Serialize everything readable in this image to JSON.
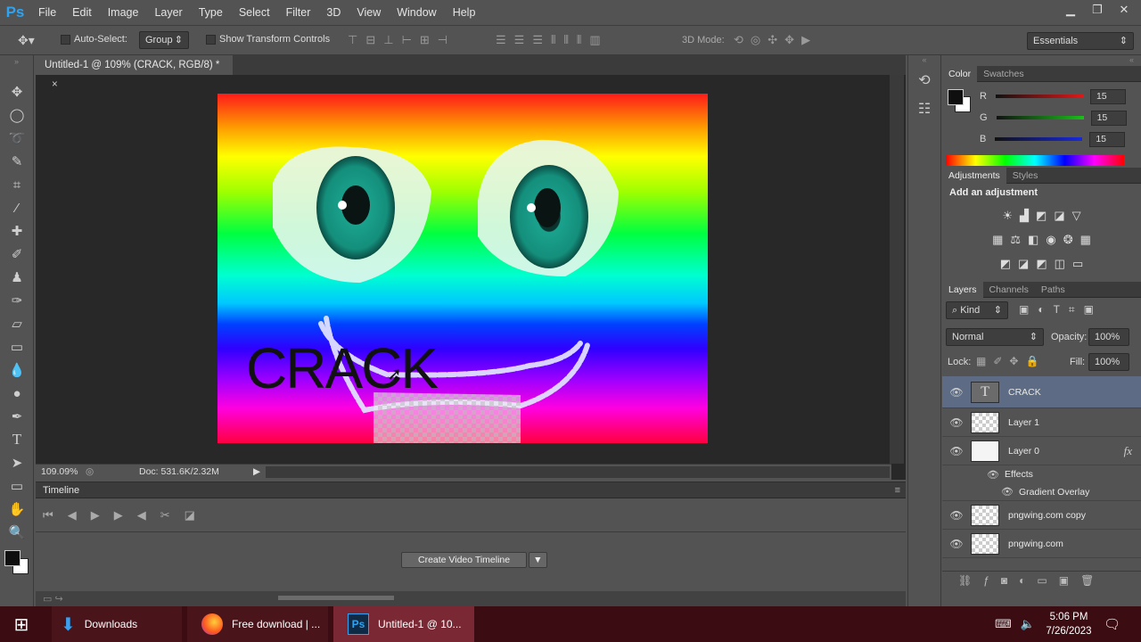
{
  "app": {
    "logo": "Ps"
  },
  "menu": [
    "File",
    "Edit",
    "Image",
    "Layer",
    "Type",
    "Select",
    "Filter",
    "3D",
    "View",
    "Window",
    "Help"
  ],
  "window_controls": {
    "minimize": "▁",
    "restore": "❐",
    "close": "✕"
  },
  "options": {
    "auto_select_label": "Auto-Select:",
    "auto_select_value": "Group",
    "show_transform_label": "Show Transform Controls",
    "mode_3d_label": "3D Mode:",
    "workspace": "Essentials"
  },
  "document": {
    "tab_title": "Untitled-1 @ 109% (CRACK, RGB/8) *",
    "tab_close": "×",
    "canvas_text": "CRACK",
    "zoom": "109.09%",
    "doc_size": "Doc: 531.6K/2.32M"
  },
  "timeline": {
    "title": "Timeline",
    "create_button": "Create Video Timeline"
  },
  "color_panel": {
    "tabs": [
      "Color",
      "Swatches"
    ],
    "r_label": "R",
    "g_label": "G",
    "b_label": "B",
    "r": "15",
    "g": "15",
    "b": "15",
    "foreground": "#0f0f0f",
    "background": "#ffffff"
  },
  "adjustments": {
    "tabs": [
      "Adjustments",
      "Styles"
    ],
    "header": "Add an adjustment"
  },
  "layers_panel": {
    "tabs": [
      "Layers",
      "Channels",
      "Paths"
    ],
    "filter_kind": "Kind",
    "blend_mode": "Normal",
    "opacity_label": "Opacity:",
    "opacity": "100%",
    "lock_label": "Lock:",
    "fill_label": "Fill:",
    "fill": "100%",
    "fx_label": "fx",
    "layers": [
      {
        "name": "CRACK",
        "thumb_glyph": "T"
      },
      {
        "name": "Layer 1"
      },
      {
        "name": "Layer 0"
      },
      {
        "name": "Effects"
      },
      {
        "name": "Gradient Overlay"
      },
      {
        "name": "pngwing.com copy"
      },
      {
        "name": "pngwing.com"
      }
    ]
  },
  "taskbar": {
    "items": [
      "Downloads",
      "Free download | ...",
      "Untitled-1 @ 10..."
    ],
    "ps_icon": "Ps",
    "time": "5:06 PM",
    "date": "7/26/2023"
  }
}
